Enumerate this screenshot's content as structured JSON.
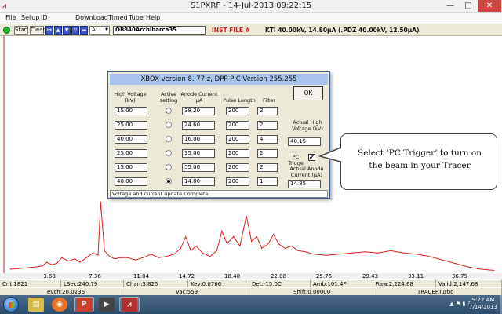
{
  "window": {
    "title": "S1PXRF - 14-Jul-2013 09:22:15",
    "minimize": "—",
    "maximize": "□",
    "close": "✕"
  },
  "menu": [
    "File",
    "Setup",
    "ID",
    "DownLoad",
    "Timed",
    "Tube",
    "Help"
  ],
  "toolbar": {
    "start_label": "Start",
    "clear_label": "Clear",
    "channel_select": "A",
    "sample_name": "OB840Archibarca35",
    "inst_file": "INST FILE #",
    "kv_status": "KTI 40.00kV, 14.80µA (.PDZ 40.00kV, 12.50µA)"
  },
  "dialog": {
    "title": "XBOX version  8. 77.z, DPP PIC Version 255.255",
    "headers": {
      "high_voltage": "High Voltage (kV)",
      "active": "Active setting",
      "anode_current": "Anode Current µA",
      "pulse_length": "Pulse Length",
      "filter": "Filter"
    },
    "rows": [
      {
        "kv": "15.00",
        "ua": "38.20",
        "pulse": "200",
        "filter": "2",
        "active": false
      },
      {
        "kv": "25.00",
        "ua": "24.60",
        "pulse": "200",
        "filter": "2",
        "active": false
      },
      {
        "kv": "40.00",
        "ua": "16.00",
        "pulse": "200",
        "filter": "4",
        "active": false
      },
      {
        "kv": "25.00",
        "ua": "35.00",
        "pulse": "200",
        "filter": "2",
        "active": false
      },
      {
        "kv": "15.00",
        "ua": "55.00",
        "pulse": "200",
        "filter": "2",
        "active": false
      },
      {
        "kv": "40.00",
        "ua": "14.80",
        "pulse": "200",
        "filter": "1",
        "active": true
      }
    ],
    "ok_label": "OK",
    "actual_hv_label": "Actual High Voltage (kV)",
    "actual_hv_value": "40.15",
    "pc_trigger_label": "PC Trigge",
    "pc_trigger_checked": "✔",
    "actual_anode_label": "Actual Anode Current (µA)",
    "actual_anode_value": "14.85",
    "status": "Voltage and current update Complete"
  },
  "callout": {
    "line1": "Select ‘PC Trigger’ to turn on",
    "line2": "the beam in your Tracer"
  },
  "chart_data": {
    "type": "line",
    "x_ticks": [
      "3.68",
      "7.36",
      "11.04",
      "14.72",
      "18.40",
      "22.08",
      "25.76",
      "29.43",
      "33.11",
      "36.79"
    ],
    "x": [
      0.5,
      1.5,
      2.5,
      3.0,
      3.3,
      3.7,
      4.1,
      4.5,
      5.0,
      5.5,
      5.9,
      6.4,
      6.9,
      7.3,
      7.5,
      7.8,
      8.2,
      8.6,
      9.0,
      9.6,
      10.2,
      10.8,
      11.4,
      12.0,
      12.6,
      13.2,
      13.7,
      14.1,
      14.5,
      14.9,
      15.4,
      16.0,
      16.5,
      16.9,
      17.3,
      17.8,
      18.3,
      18.8,
      19.2,
      19.6,
      20.0,
      20.5,
      20.9,
      21.3,
      21.8,
      22.3,
      22.8,
      23.4,
      24.0,
      25.0,
      26.0,
      27.0,
      28.0,
      29.0,
      30.0,
      31.0,
      32.0,
      33.0,
      34.0,
      35.0,
      36.0,
      37.0,
      38.0
    ],
    "y": [
      2,
      3,
      4,
      5,
      8,
      6,
      7,
      12,
      9,
      11,
      8,
      12,
      16,
      14,
      60,
      18,
      13,
      11,
      12,
      12,
      10,
      12,
      15,
      12,
      13,
      15,
      20,
      30,
      18,
      22,
      16,
      13,
      18,
      35,
      24,
      30,
      22,
      48,
      26,
      30,
      20,
      24,
      32,
      24,
      20,
      22,
      18,
      17,
      15,
      14,
      15,
      16,
      17,
      16,
      18,
      16,
      15,
      13,
      10,
      7,
      4,
      2,
      1
    ],
    "xlim": [
      0,
      38.5
    ],
    "ylim": [
      0,
      100
    ],
    "color": "#e02020"
  },
  "status_bar": {
    "cnt": "Cnt:1821",
    "lsec": "LSec:240.79",
    "chan": "Chan:3.825",
    "kev": "Kev:0.0766",
    "det": "Det:-15.0C",
    "amb": "Amb:101.4F",
    "raw": "Raw:2,224.68",
    "valid": "Valid:2,147.68",
    "evch": "evch:20.0236",
    "vac": "Vac:559",
    "shift": "Shift:0.00000",
    "model": "TRACERTurbo"
  },
  "taskbar": {
    "time": "9:22 AM",
    "date": "7/14/2013"
  },
  "colors": {
    "accent": "#3d55c4",
    "spectrum": "#e02020",
    "inst_file": "#d81818",
    "led": "#22b422"
  }
}
